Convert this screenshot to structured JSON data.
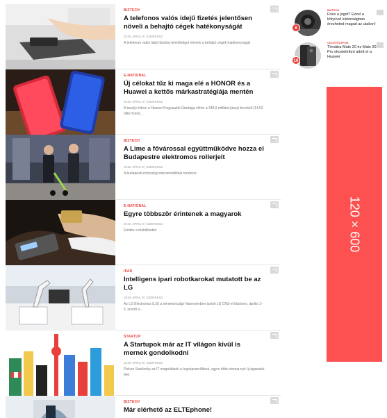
{
  "articles": [
    {
      "tag": "BIZTECH",
      "title": "A telefonos valós idejű fizetés jelentősen növeli a behajtó cégek hatékonyságát",
      "meta": "2019. APRIL 9 | SZERKESZ",
      "excerpt": "A telefonon valós idejű fizetési lehetőséget növelni a behajtó cégek hatékonyságát"
    },
    {
      "tag": "E-NATIONAL",
      "title": "Új célokat tűz ki maga elé a HONOR és a Huawei a kettős márkastratégiája mentén",
      "meta": "2019. APRIL 9 | SZERKESZ",
      "excerpt": "A tavalyi évben a Huawei Fogyasztói Üzletága elérte a 348,9 milliárd jüanyi bevételt (14,52 billió forint)..."
    },
    {
      "tag": "BIZTECH",
      "title": "A Lime a fővárossal együttműködve hozza el Budapestre elektromos rollerjeit",
      "meta": "2019. APRIL 9 | SZERKESZ",
      "excerpt": "A budapesti közösségi mikromobilitási rendszer"
    },
    {
      "tag": "E-NATIONAL",
      "title": "Egyre többször érintenek a magyarok",
      "meta": "2019. APRIL 9 | SZERKESZ",
      "excerpt": "Érintés a mobilfizetés"
    },
    {
      "tag": "IPAR",
      "title": "Intelligens ipari robotkarokat mutatott be az LG",
      "meta": "2019. APRIL 8 | SZERKESZ",
      "excerpt": "Az LG Electronics (LG) a németországi Hannoverben tartott LG CNS-el közösen, április 1–5. között a..."
    },
    {
      "tag": "STARTUP",
      "title": "A Startupok már az IT világon kívül is mernek gondolkodni",
      "meta": "2019. APRIL 8 | SZERKESZ",
      "excerpt": "Polcon Swolinsky az IT megoldások a legnépszerűbbek, egyre több startup nyit új ágazatok felé."
    },
    {
      "tag": "BIZTECH",
      "title": "Már elérhető az ELTEphone!",
      "meta": "",
      "excerpt": ""
    }
  ],
  "popular": [
    {
      "number": "8",
      "tag": "BIZTECH",
      "title": "Fries a jogot? Ezzel a kötyüvel kistonságban érezheted magad az utakon!"
    },
    {
      "number": "10",
      "tag": "OKOSTELEFON",
      "title": "Tömátra Mate 20 és Mate 20 Pro okostelefont adott el a Huawei"
    }
  ],
  "ad": {
    "label": "120 × 600",
    "color": "#fd5151"
  },
  "colors": {
    "accent": "#e8413c"
  }
}
